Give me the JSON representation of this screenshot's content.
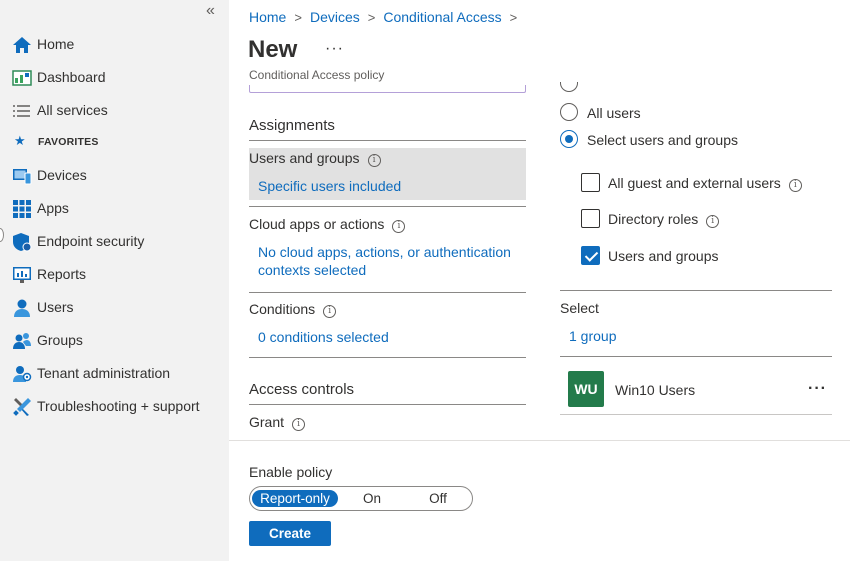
{
  "sidebar": {
    "collapse_glyph": "«",
    "favorites_label": "FAVORITES",
    "items": [
      {
        "label": "Home",
        "icon": "home-icon"
      },
      {
        "label": "Dashboard",
        "icon": "dashboard-icon"
      },
      {
        "label": "All services",
        "icon": "list-icon"
      },
      {
        "label": "Devices",
        "icon": "devices-icon"
      },
      {
        "label": "Apps",
        "icon": "apps-grid-icon"
      },
      {
        "label": "Endpoint security",
        "icon": "shield-icon"
      },
      {
        "label": "Reports",
        "icon": "reports-icon"
      },
      {
        "label": "Users",
        "icon": "user-icon"
      },
      {
        "label": "Groups",
        "icon": "groups-icon"
      },
      {
        "label": "Tenant administration",
        "icon": "tenant-admin-icon"
      },
      {
        "label": "Troubleshooting + support",
        "icon": "tools-icon"
      }
    ]
  },
  "breadcrumb": {
    "items": [
      "Home",
      "Devices",
      "Conditional Access"
    ],
    "separator": ">"
  },
  "page": {
    "title": "New",
    "more": "···",
    "subtitle": "Conditional Access policy"
  },
  "left_pane": {
    "assignments_heading": "Assignments",
    "users_groups_label": "Users and groups",
    "users_groups_value": "Specific users included",
    "cloud_apps_label": "Cloud apps or actions",
    "cloud_apps_value_line1": "No cloud apps, actions, or authentication",
    "cloud_apps_value_line2": "contexts selected",
    "conditions_label": "Conditions",
    "conditions_value": "0 conditions selected",
    "access_controls_heading": "Access controls",
    "grant_label": "Grant"
  },
  "right_pane": {
    "radio_all_users": "All users",
    "radio_select_users": "Select users and groups",
    "selected_radio": "Select users and groups",
    "check_guest": "All guest and external users",
    "check_directory_roles": "Directory roles",
    "check_users_groups": "Users and groups",
    "checked": [
      "Users and groups"
    ],
    "select_label": "Select",
    "select_value": "1 group",
    "group_avatar": "WU",
    "group_name": "Win10 Users",
    "row_more": "···",
    "avatar_color": "#237b4b"
  },
  "footer": {
    "enable_policy_label": "Enable policy",
    "options": [
      "Report-only",
      "On",
      "Off"
    ],
    "selected": "Report-only",
    "create_label": "Create"
  },
  "colors": {
    "accent": "#0f6cbd",
    "sidebar_bg": "#f2f2f2"
  }
}
